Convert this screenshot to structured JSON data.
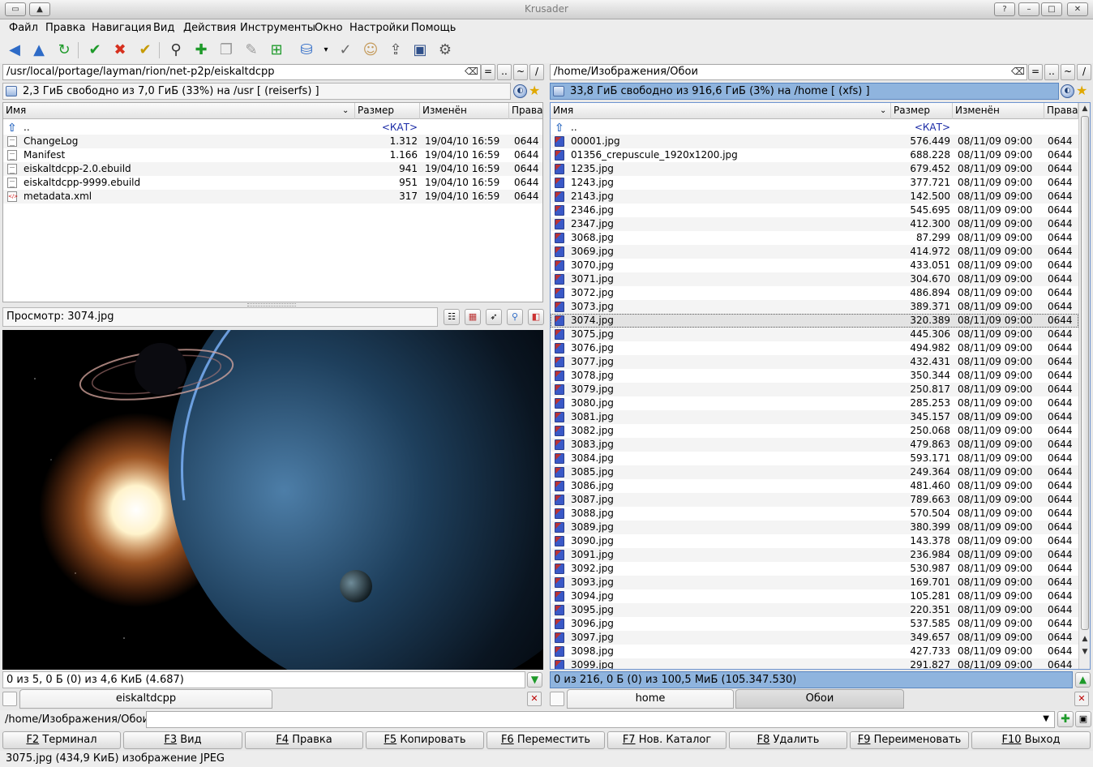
{
  "window": {
    "title": "Krusader"
  },
  "menu": [
    "Файл",
    "Правка",
    "Навигация",
    "Вид",
    "Действия",
    "Инструменты",
    "Окно",
    "Настройки",
    "Помощь"
  ],
  "left": {
    "path": "/usr/local/portage/layman/rion/net-p2p/eiskaltdcpp",
    "free": "2,3 ГиБ свободно из 7,0 ГиБ (33%) на /usr [ (reiserfs) ]",
    "columns": [
      "Имя",
      "Размер",
      "Изменён",
      "Права"
    ],
    "rows": [
      {
        "name": "..",
        "size": "<КАТ>",
        "date": "",
        "perm": "",
        "type": "up"
      },
      {
        "name": "ChangeLog",
        "size": "1.312",
        "date": "19/04/10 16:59",
        "perm": "0644",
        "type": "doc"
      },
      {
        "name": "Manifest",
        "size": "1.166",
        "date": "19/04/10 16:59",
        "perm": "0644",
        "type": "doc"
      },
      {
        "name": "eiskaltdcpp-2.0.ebuild",
        "size": "941",
        "date": "19/04/10 16:59",
        "perm": "0644",
        "type": "doc"
      },
      {
        "name": "eiskaltdcpp-9999.ebuild",
        "size": "951",
        "date": "19/04/10 16:59",
        "perm": "0644",
        "type": "doc"
      },
      {
        "name": "metadata.xml",
        "size": "317",
        "date": "19/04/10 16:59",
        "perm": "0644",
        "type": "xml"
      }
    ],
    "preview_label": "Просмотр: 3074.jpg",
    "status": "0 из 5, 0 Б (0) из 4,6 КиБ (4.687)",
    "tabs": [
      "eiskaltdcpp"
    ]
  },
  "right": {
    "path": "/home/Изображения/Обои",
    "free": "33,8 ГиБ свободно из 916,6 ГиБ (3%) на /home [ (xfs) ]",
    "columns": [
      "Имя",
      "Размер",
      "Изменён",
      "Права"
    ],
    "rows": [
      {
        "name": "..",
        "size": "<КАТ>",
        "date": "",
        "perm": "",
        "type": "up"
      },
      {
        "name": "00001.jpg",
        "size": "576.449",
        "date": "08/11/09 09:00",
        "perm": "0644",
        "type": "img"
      },
      {
        "name": "01356_crepuscule_1920x1200.jpg",
        "size": "688.228",
        "date": "08/11/09 09:00",
        "perm": "0644",
        "type": "img"
      },
      {
        "name": "1235.jpg",
        "size": "679.452",
        "date": "08/11/09 09:00",
        "perm": "0644",
        "type": "img"
      },
      {
        "name": "1243.jpg",
        "size": "377.721",
        "date": "08/11/09 09:00",
        "perm": "0644",
        "type": "img"
      },
      {
        "name": "2143.jpg",
        "size": "142.500",
        "date": "08/11/09 09:00",
        "perm": "0644",
        "type": "img"
      },
      {
        "name": "2346.jpg",
        "size": "545.695",
        "date": "08/11/09 09:00",
        "perm": "0644",
        "type": "img"
      },
      {
        "name": "2347.jpg",
        "size": "412.300",
        "date": "08/11/09 09:00",
        "perm": "0644",
        "type": "img"
      },
      {
        "name": "3068.jpg",
        "size": "87.299",
        "date": "08/11/09 09:00",
        "perm": "0644",
        "type": "img"
      },
      {
        "name": "3069.jpg",
        "size": "414.972",
        "date": "08/11/09 09:00",
        "perm": "0644",
        "type": "img"
      },
      {
        "name": "3070.jpg",
        "size": "433.051",
        "date": "08/11/09 09:00",
        "perm": "0644",
        "type": "img"
      },
      {
        "name": "3071.jpg",
        "size": "304.670",
        "date": "08/11/09 09:00",
        "perm": "0644",
        "type": "img"
      },
      {
        "name": "3072.jpg",
        "size": "486.894",
        "date": "08/11/09 09:00",
        "perm": "0644",
        "type": "img"
      },
      {
        "name": "3073.jpg",
        "size": "389.371",
        "date": "08/11/09 09:00",
        "perm": "0644",
        "type": "img"
      },
      {
        "name": "3074.jpg",
        "size": "320.389",
        "date": "08/11/09 09:00",
        "perm": "0644",
        "type": "img",
        "selected": true
      },
      {
        "name": "3075.jpg",
        "size": "445.306",
        "date": "08/11/09 09:00",
        "perm": "0644",
        "type": "img"
      },
      {
        "name": "3076.jpg",
        "size": "494.982",
        "date": "08/11/09 09:00",
        "perm": "0644",
        "type": "img"
      },
      {
        "name": "3077.jpg",
        "size": "432.431",
        "date": "08/11/09 09:00",
        "perm": "0644",
        "type": "img"
      },
      {
        "name": "3078.jpg",
        "size": "350.344",
        "date": "08/11/09 09:00",
        "perm": "0644",
        "type": "img"
      },
      {
        "name": "3079.jpg",
        "size": "250.817",
        "date": "08/11/09 09:00",
        "perm": "0644",
        "type": "img"
      },
      {
        "name": "3080.jpg",
        "size": "285.253",
        "date": "08/11/09 09:00",
        "perm": "0644",
        "type": "img"
      },
      {
        "name": "3081.jpg",
        "size": "345.157",
        "date": "08/11/09 09:00",
        "perm": "0644",
        "type": "img"
      },
      {
        "name": "3082.jpg",
        "size": "250.068",
        "date": "08/11/09 09:00",
        "perm": "0644",
        "type": "img"
      },
      {
        "name": "3083.jpg",
        "size": "479.863",
        "date": "08/11/09 09:00",
        "perm": "0644",
        "type": "img"
      },
      {
        "name": "3084.jpg",
        "size": "593.171",
        "date": "08/11/09 09:00",
        "perm": "0644",
        "type": "img"
      },
      {
        "name": "3085.jpg",
        "size": "249.364",
        "date": "08/11/09 09:00",
        "perm": "0644",
        "type": "img"
      },
      {
        "name": "3086.jpg",
        "size": "481.460",
        "date": "08/11/09 09:00",
        "perm": "0644",
        "type": "img"
      },
      {
        "name": "3087.jpg",
        "size": "789.663",
        "date": "08/11/09 09:00",
        "perm": "0644",
        "type": "img"
      },
      {
        "name": "3088.jpg",
        "size": "570.504",
        "date": "08/11/09 09:00",
        "perm": "0644",
        "type": "img"
      },
      {
        "name": "3089.jpg",
        "size": "380.399",
        "date": "08/11/09 09:00",
        "perm": "0644",
        "type": "img"
      },
      {
        "name": "3090.jpg",
        "size": "143.378",
        "date": "08/11/09 09:00",
        "perm": "0644",
        "type": "img"
      },
      {
        "name": "3091.jpg",
        "size": "236.984",
        "date": "08/11/09 09:00",
        "perm": "0644",
        "type": "img"
      },
      {
        "name": "3092.jpg",
        "size": "530.987",
        "date": "08/11/09 09:00",
        "perm": "0644",
        "type": "img"
      },
      {
        "name": "3093.jpg",
        "size": "169.701",
        "date": "08/11/09 09:00",
        "perm": "0644",
        "type": "img"
      },
      {
        "name": "3094.jpg",
        "size": "105.281",
        "date": "08/11/09 09:00",
        "perm": "0644",
        "type": "img"
      },
      {
        "name": "3095.jpg",
        "size": "220.351",
        "date": "08/11/09 09:00",
        "perm": "0644",
        "type": "img"
      },
      {
        "name": "3096.jpg",
        "size": "537.585",
        "date": "08/11/09 09:00",
        "perm": "0644",
        "type": "img"
      },
      {
        "name": "3097.jpg",
        "size": "349.657",
        "date": "08/11/09 09:00",
        "perm": "0644",
        "type": "img"
      },
      {
        "name": "3098.jpg",
        "size": "427.733",
        "date": "08/11/09 09:00",
        "perm": "0644",
        "type": "img"
      },
      {
        "name": "3099.jpg",
        "size": "291.827",
        "date": "08/11/09 09:00",
        "perm": "0644",
        "type": "img"
      }
    ],
    "status": "0 из 216, 0 Б (0) из 100,5 МиБ (105.347.530)",
    "tabs": [
      "home",
      "Обои"
    ]
  },
  "cmdline": {
    "prompt": "/home/Изображения/Обои>"
  },
  "fkeys": [
    {
      "key": "F2",
      "label": " Терминал"
    },
    {
      "key": "F3",
      "label": " Вид"
    },
    {
      "key": "F4",
      "label": " Правка"
    },
    {
      "key": "F5",
      "label": " Копировать"
    },
    {
      "key": "F6",
      "label": " Переместить"
    },
    {
      "key": "F7",
      "label": " Нов. Каталог"
    },
    {
      "key": "F8",
      "label": " Удалить"
    },
    {
      "key": "F9",
      "label": " Переименовать"
    },
    {
      "key": "F10",
      "label": " Выход"
    }
  ],
  "bottom_status": "3075.jpg (434,9 КиБ)   изображение JPEG",
  "buttons": {
    "equal": "=",
    "up": "..",
    "home": "~",
    "root": "/"
  },
  "colors": {
    "active_bar": "#8fb4de",
    "selected_row": "#e3e3e3"
  },
  "icons": [
    "back-icon",
    "up-icon",
    "refresh-icon",
    "select-icon",
    "unselect-icon",
    "compare-icon",
    "search-icon",
    "new-file-icon",
    "copy-icon",
    "edit-icon",
    "add-icon",
    "network-icon",
    "checksum-icon",
    "user-icon",
    "disk-usage-icon",
    "terminal-icon",
    "settings-icon"
  ]
}
